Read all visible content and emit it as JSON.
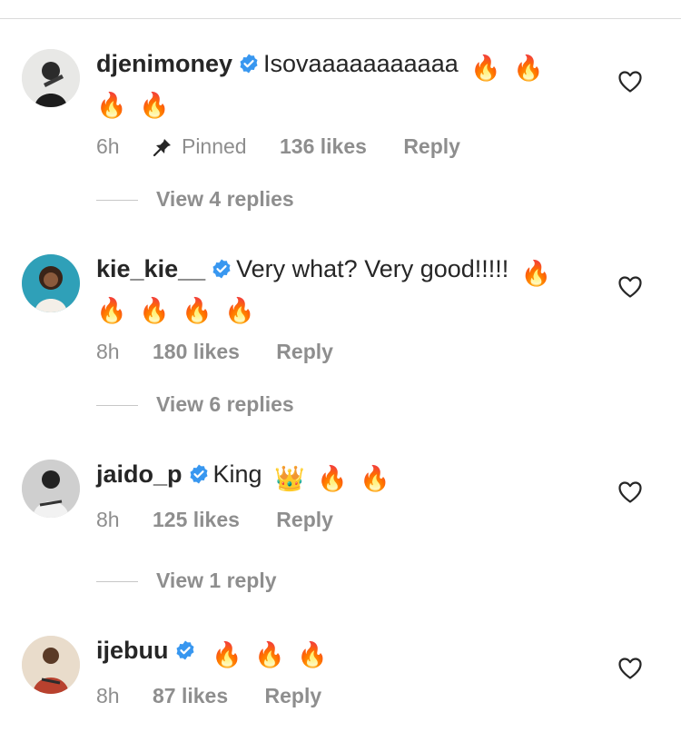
{
  "comments": [
    {
      "username": "djenimoney",
      "text": "Isovaaaaaaaaaaa",
      "emojis": [
        "🔥",
        "🔥",
        "🔥",
        "🔥"
      ],
      "time": "6h",
      "pinned": "Pinned",
      "likes": "136 likes",
      "reply": "Reply",
      "view_replies": "View 4 replies"
    },
    {
      "username": "kie_kie__",
      "text": "Very what? Very good!!!!!",
      "emojis": [
        "🔥",
        "🔥",
        "🔥",
        "🔥",
        "🔥"
      ],
      "time": "8h",
      "likes": "180 likes",
      "reply": "Reply",
      "view_replies": "View 6 replies"
    },
    {
      "username": "jaido_p",
      "text": "King",
      "emojis": [
        "👑",
        "🔥",
        "🔥"
      ],
      "time": "8h",
      "likes": "125 likes",
      "reply": "Reply",
      "view_replies": "View 1 reply"
    },
    {
      "username": "ijebuu",
      "text": "",
      "emojis": [
        "🔥",
        "🔥",
        "🔥"
      ],
      "time": "8h",
      "likes": "87 likes",
      "reply": "Reply"
    }
  ],
  "icons": {
    "verified": "verified-badge-icon",
    "pin": "pin-icon",
    "heart": "heart-outline-icon",
    "fire": "fire-emoji-icon",
    "crown": "crown-emoji-icon"
  },
  "colors": {
    "verified": "#3897f0",
    "meta_text": "#8e8e8e",
    "text": "#262626"
  }
}
